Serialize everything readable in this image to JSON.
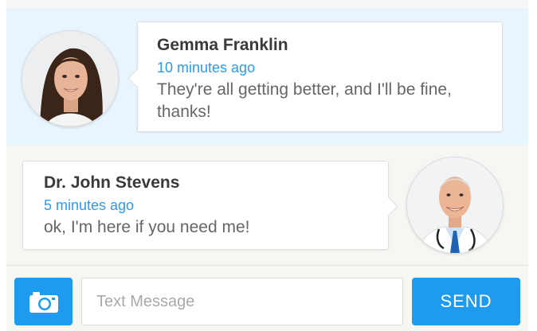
{
  "messages": [
    {
      "sender": "Gemma Franklin",
      "time": "10 minutes ago",
      "text": "They're all getting better, and I'll be fine, thanks!",
      "side": "left"
    },
    {
      "sender": "Dr. John Stevens",
      "time": "5 minutes ago",
      "text": "ok, I'm here if you need me!",
      "side": "right"
    }
  ],
  "composer": {
    "camera_icon": "camera-icon",
    "placeholder": "Text Message",
    "value": "",
    "send_label": "SEND"
  },
  "colors": {
    "accent": "#1e9bee",
    "timestamp": "#2b9bef",
    "incoming_row_bg": "#e8f5fd",
    "outgoing_row_bg": "#f7f6f2"
  }
}
